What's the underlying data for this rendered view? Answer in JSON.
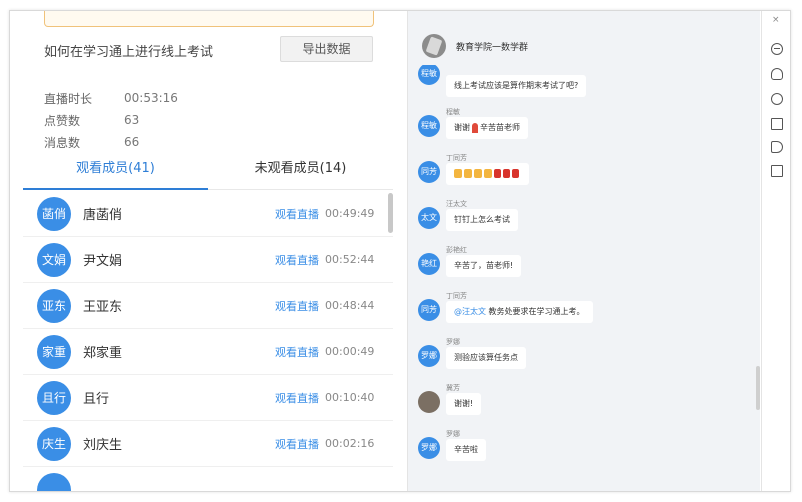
{
  "left": {
    "course_title": "如何在学习通上进行线上考试",
    "export_label": "导出数据",
    "stats": [
      {
        "label": "直播时长",
        "value": "00:53:16"
      },
      {
        "label": "点赞数",
        "value": "63"
      },
      {
        "label": "消息数",
        "value": "66"
      }
    ],
    "tabs": [
      {
        "label": "观看成员(41)",
        "active": true
      },
      {
        "label": "未观看成员(14)",
        "active": false
      }
    ],
    "members": [
      {
        "avatar": "菡俏",
        "name": "唐菡俏",
        "action": "观看直播",
        "time": "00:49:49"
      },
      {
        "avatar": "文娟",
        "name": "尹文娟",
        "action": "观看直播",
        "time": "00:52:44"
      },
      {
        "avatar": "亚东",
        "name": "王亚东",
        "action": "观看直播",
        "time": "00:48:44"
      },
      {
        "avatar": "家重",
        "name": "郑家重",
        "action": "观看直播",
        "time": "00:00:49"
      },
      {
        "avatar": "且行",
        "name": "且行",
        "action": "观看直播",
        "time": "00:10:40"
      },
      {
        "avatar": "庆生",
        "name": "刘庆生",
        "action": "观看直播",
        "time": "00:02:16"
      }
    ]
  },
  "right": {
    "group_name": "教育学院一数学群",
    "messages": [
      {
        "avatar": "程敏",
        "sender": "",
        "text": "线上考试应该是算作期末考试了吧?"
      },
      {
        "avatar": "程敏",
        "sender": "程敏",
        "text_pre": "谢谢",
        "text_post": "辛苦苗老师"
      },
      {
        "avatar": "同芳",
        "sender": "丁同芳",
        "reaction": "thumbs-and-medals"
      },
      {
        "avatar": "太文",
        "sender": "汪太文",
        "text": "钉钉上怎么考试"
      },
      {
        "avatar": "艳红",
        "sender": "彭艳红",
        "text": "辛苦了，苗老师!"
      },
      {
        "avatar": "同芳",
        "sender": "丁同芳",
        "mention": "@汪太文",
        "text": " 教务处要求在学习通上考。"
      },
      {
        "avatar": "罗娜",
        "sender": "罗娜",
        "text": "测验应该算任务点"
      },
      {
        "avatar": "",
        "sender": "冀芳",
        "text": "谢谢!"
      },
      {
        "avatar": "罗娜",
        "sender": "罗娜",
        "text": "辛苦啦"
      }
    ]
  },
  "close_label": "×"
}
